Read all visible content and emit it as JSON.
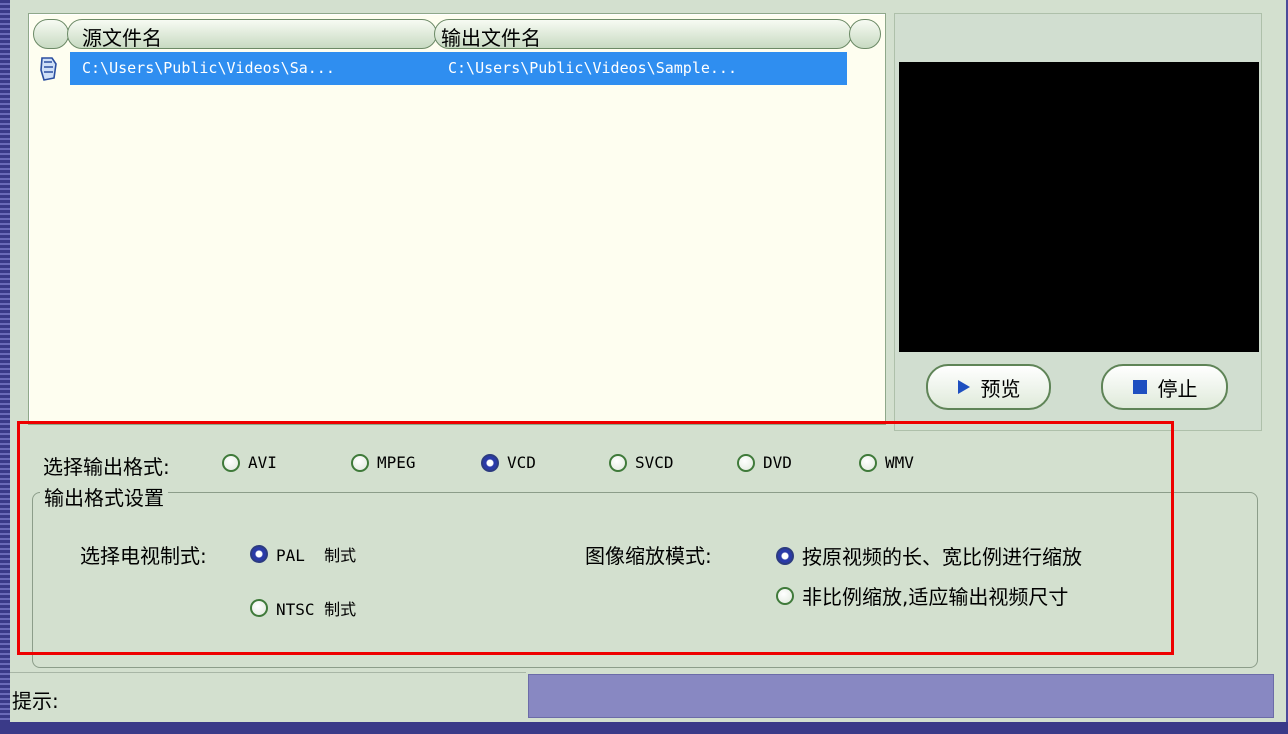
{
  "file_list": {
    "columns": [
      "源文件名",
      "输出文件名"
    ],
    "rows": [
      {
        "source": "C:\\Users\\Public\\Videos\\Sa...",
        "output": "C:\\Users\\Public\\Videos\\Sample..."
      }
    ]
  },
  "preview": {
    "preview_button": "预览",
    "stop_button": "停止"
  },
  "output_format": {
    "label": "选择输出格式:",
    "options": [
      "AVI",
      "MPEG",
      "VCD",
      "SVCD",
      "DVD",
      "WMV"
    ],
    "selected": "VCD"
  },
  "format_settings": {
    "title": "输出格式设置",
    "tv_system": {
      "label": "选择电视制式:",
      "options": [
        "PAL  制式",
        "NTSC 制式"
      ],
      "selected": "PAL  制式"
    },
    "scale_mode": {
      "label": "图像缩放模式:",
      "options": [
        "按原视频的长、宽比例进行缩放",
        "非比例缩放,适应输出视频尺寸"
      ],
      "selected": "按原视频的长、宽比例进行缩放"
    }
  },
  "status": {
    "hint_label": "提示:"
  },
  "colors": {
    "selection": "#2f8ef0",
    "highlight_border": "#ee0000",
    "progress": "#8888c2"
  }
}
